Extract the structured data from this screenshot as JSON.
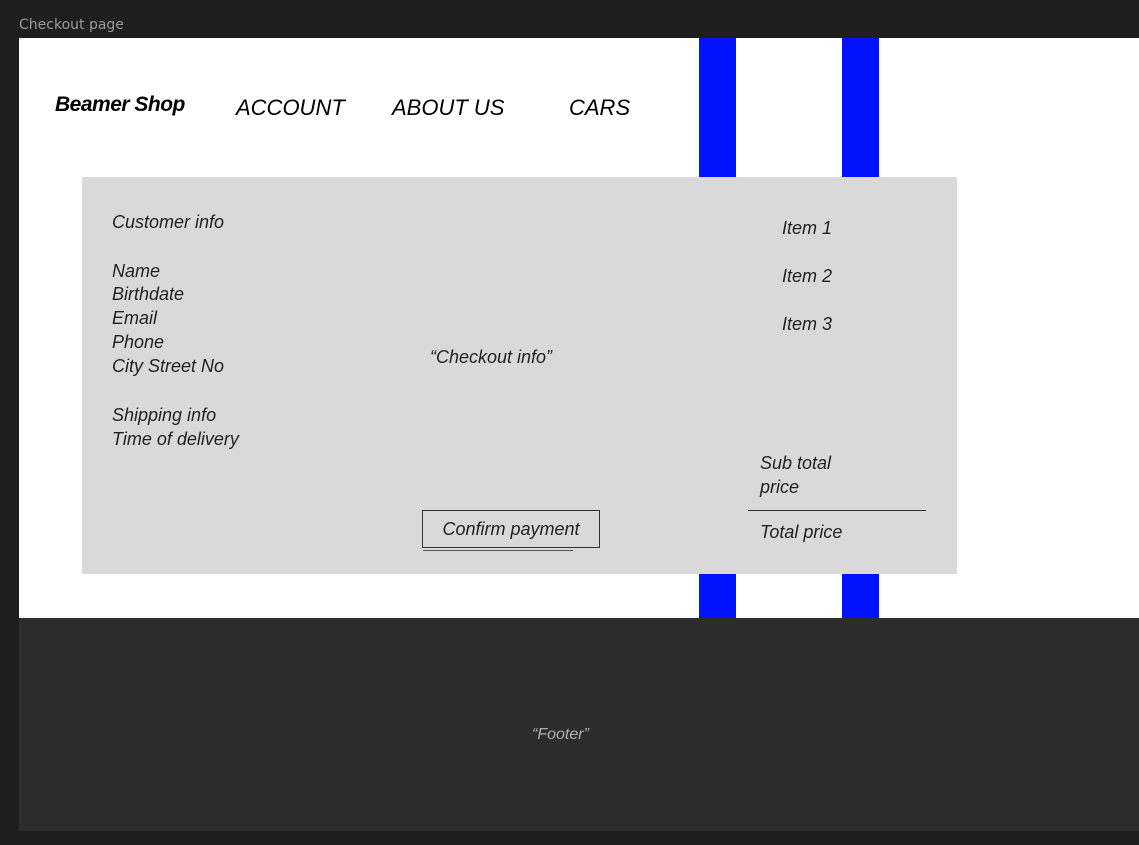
{
  "frame": {
    "label": "Checkout page"
  },
  "colors": {
    "stripe": "#0012ff",
    "card": "#d9d9d9",
    "footer": "#2c2c2c",
    "background": "#1e1e1e"
  },
  "header": {
    "brand": "Beamer Shop",
    "nav": {
      "account": "ACCOUNT",
      "about": "ABOUT US",
      "cars": "CARS"
    }
  },
  "customer": {
    "heading": "Customer info",
    "fields": {
      "name": "Name",
      "birthdate": "Birthdate",
      "email": "Email",
      "phone": "Phone",
      "address": "City Street No",
      "shipping": "Shipping info",
      "delivery_time": "Time of delivery"
    }
  },
  "checkout": {
    "info": "“Checkout info”",
    "confirm_label": "Confirm payment"
  },
  "cart": {
    "items": [
      "Item 1",
      "Item 2",
      "Item 3"
    ],
    "subtotal_label": "Sub total price",
    "total_label": "Total price"
  },
  "footer": {
    "label": "“Footer”"
  }
}
